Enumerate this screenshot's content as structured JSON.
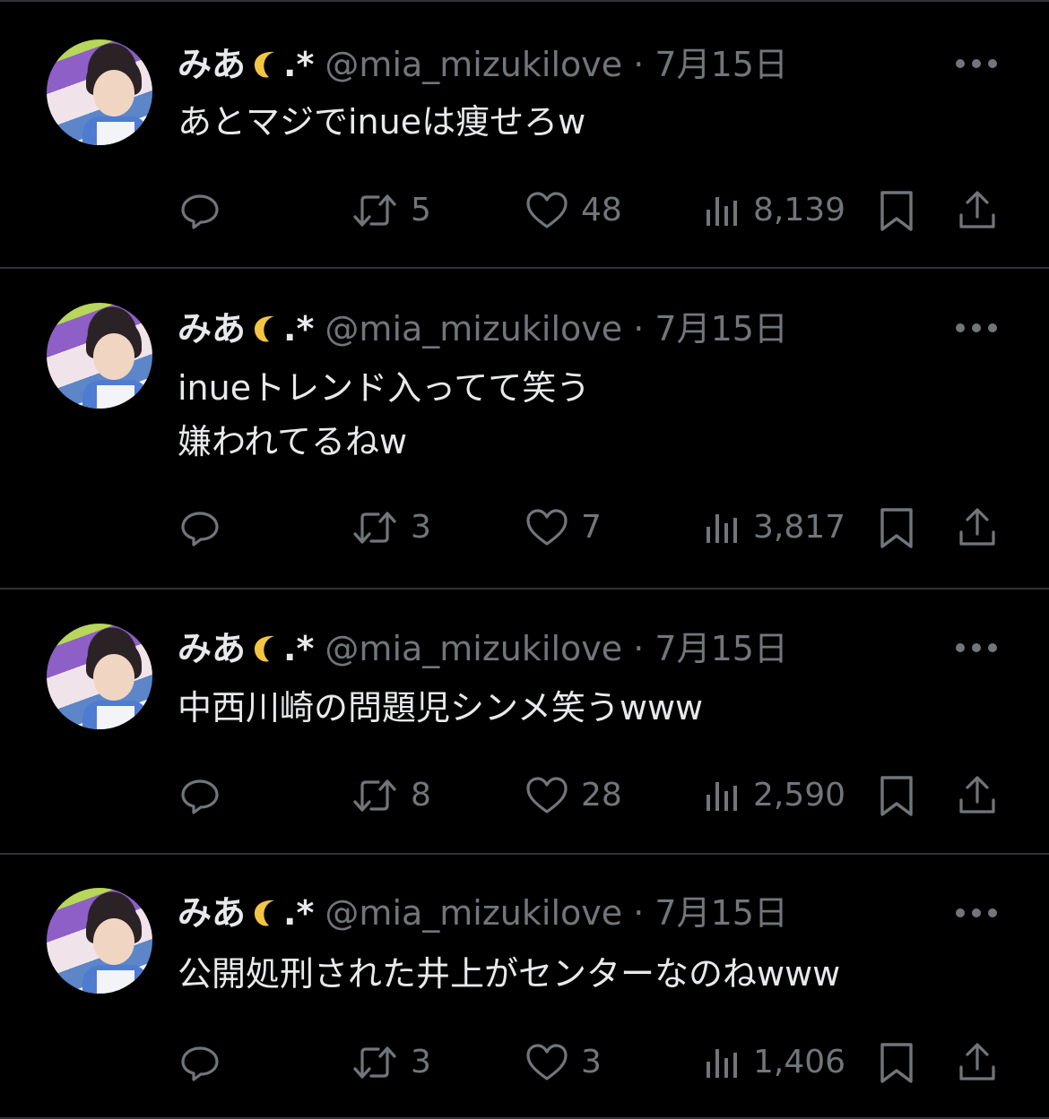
{
  "tweets": [
    {
      "name": "みあ",
      "name_suffix": ".*",
      "handle": "@mia_mizukilove",
      "separator": "·",
      "date": "7月15日",
      "text": "あとマジでinueは痩せろw",
      "retweets": "5",
      "likes": "48",
      "views": "8,139"
    },
    {
      "name": "みあ",
      "name_suffix": ".*",
      "handle": "@mia_mizukilove",
      "separator": "·",
      "date": "7月15日",
      "text": "inueトレンド入ってて笑う\n嫌われてるねw",
      "retweets": "3",
      "likes": "7",
      "views": "3,817"
    },
    {
      "name": "みあ",
      "name_suffix": ".*",
      "handle": "@mia_mizukilove",
      "separator": "·",
      "date": "7月15日",
      "text": "中西川崎の問題児シンメ笑うwww",
      "retweets": "8",
      "likes": "28",
      "views": "2,590"
    },
    {
      "name": "みあ",
      "name_suffix": ".*",
      "handle": "@mia_mizukilove",
      "separator": "·",
      "date": "7月15日",
      "text": "公開処刑された井上がセンターなのねwww",
      "retweets": "3",
      "likes": "3",
      "views": "1,406"
    }
  ],
  "icons": {
    "name_emoji": "crescent-moon-icon",
    "more": "more-dots-icon",
    "reply": "reply-icon",
    "retweet": "retweet-icon",
    "like": "heart-icon",
    "views": "views-icon",
    "bookmark": "bookmark-icon",
    "share": "share-icon"
  },
  "colors": {
    "background": "#000000",
    "text": "#e7e9ea",
    "secondary": "#71767b",
    "divider": "#2f3336",
    "moon": "#f4c542"
  }
}
